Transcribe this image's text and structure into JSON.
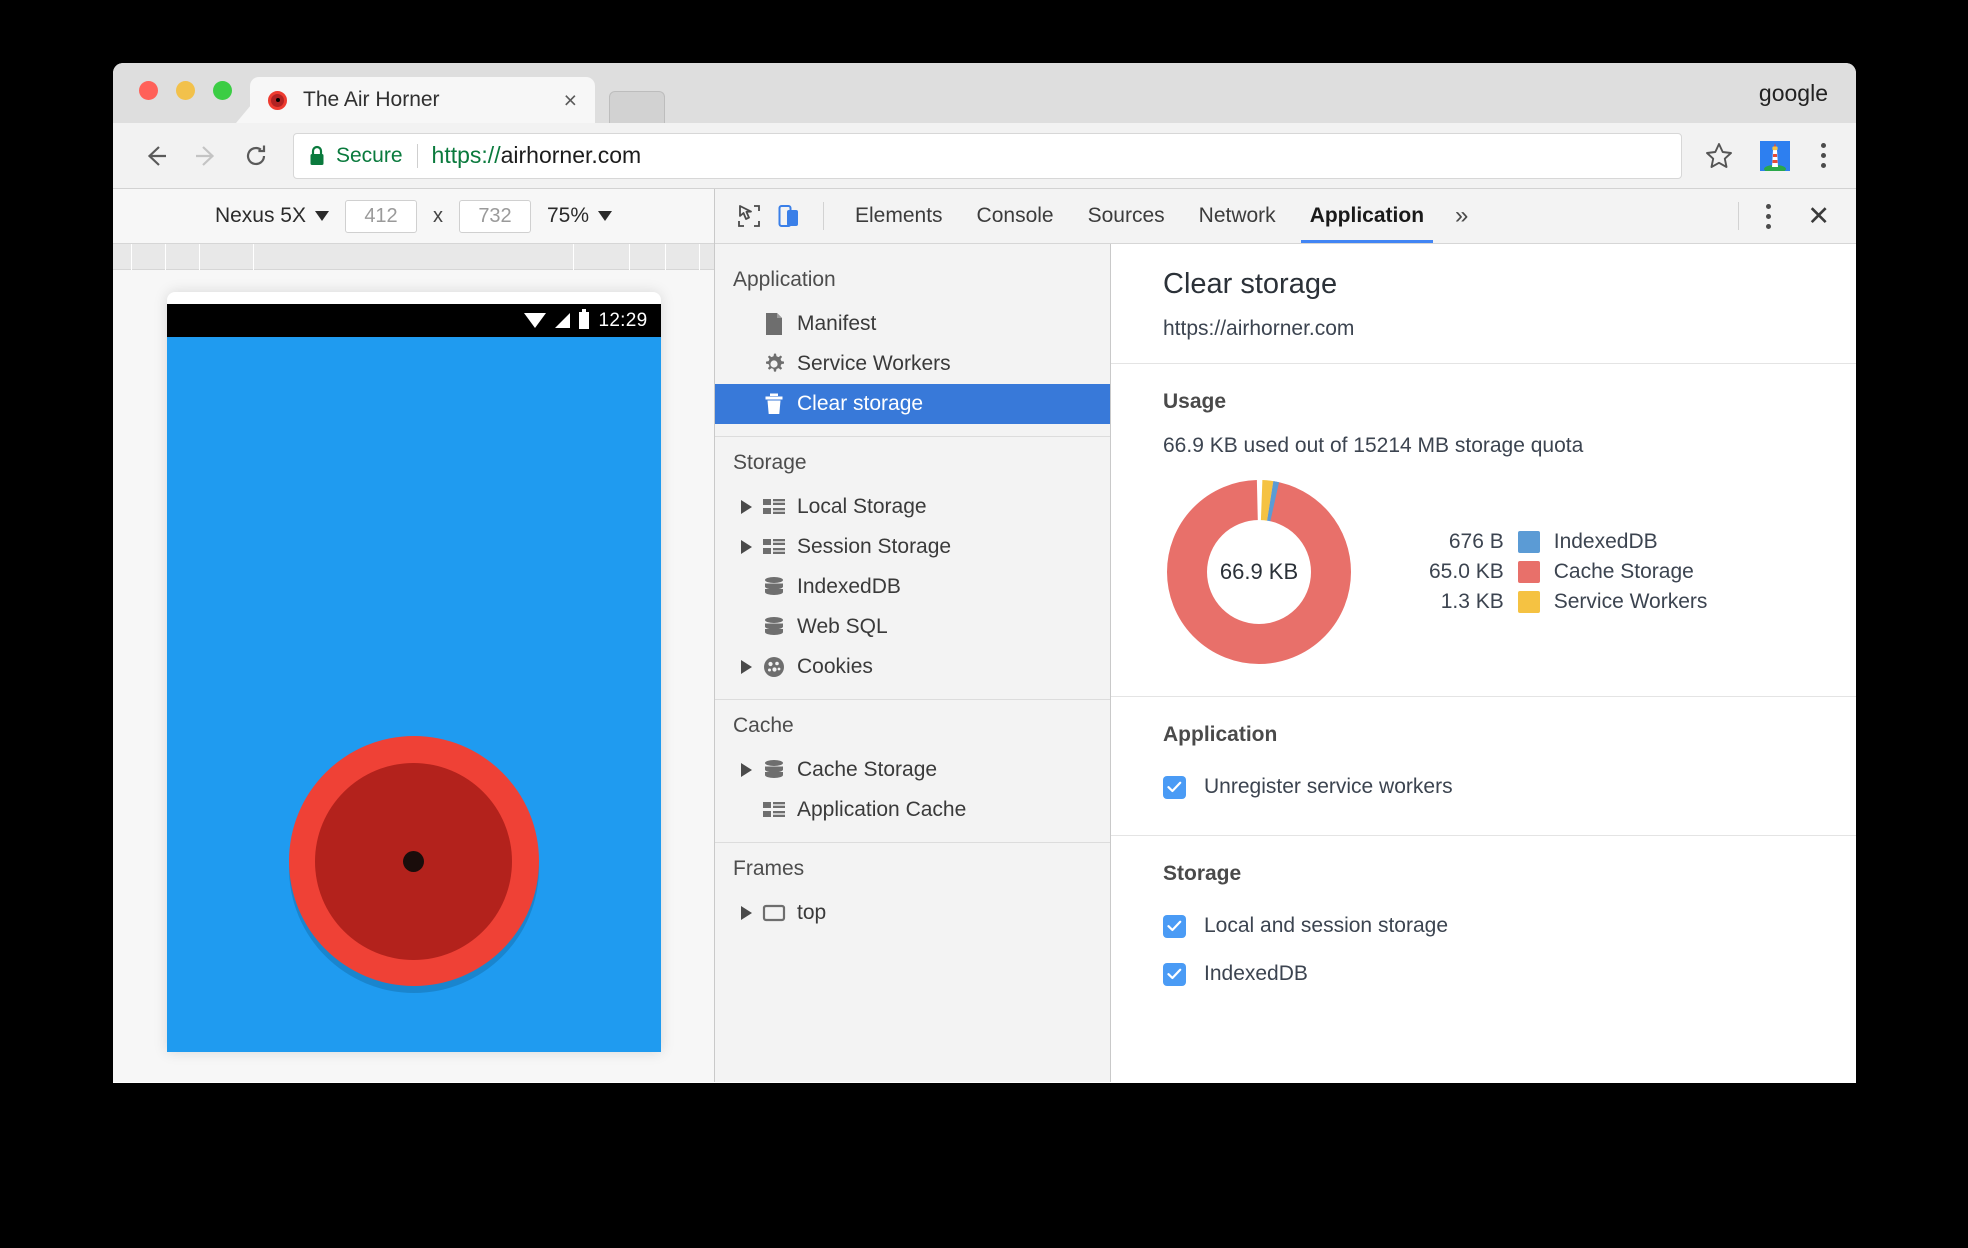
{
  "window": {
    "profile_name": "google"
  },
  "tab": {
    "title": "The Air Horner",
    "close_label": "×",
    "favicon": "air-horn-favicon"
  },
  "omnibox": {
    "secure_label": "Secure",
    "url_scheme": "https://",
    "url_host": "airhorner.com",
    "back_icon": "back-arrow-icon",
    "forward_icon": "forward-arrow-icon",
    "reload_icon": "reload-icon",
    "star_icon": "bookmark-star-icon",
    "extension_icon": "lighthouse-extension-icon",
    "menu_icon": "chrome-menu-icon"
  },
  "device_toolbar": {
    "device_name": "Nexus 5X",
    "width": "412",
    "height": "732",
    "multiply": "x",
    "zoom": "75%"
  },
  "device_screen": {
    "status_clock": "12:29",
    "wifi_icon": "wifi-icon",
    "signal_icon": "cell-signal-icon",
    "battery_icon": "battery-icon",
    "horn_button": "air-horn-button",
    "background_color": "#1f9bf0",
    "horn_outer_color": "#ef4136",
    "horn_inner_color": "#b3221c"
  },
  "devtools": {
    "inspect_icon": "inspect-element-icon",
    "device_toggle_icon": "toggle-device-toolbar-icon",
    "tabs": [
      {
        "label": "Elements",
        "active": false
      },
      {
        "label": "Console",
        "active": false
      },
      {
        "label": "Sources",
        "active": false
      },
      {
        "label": "Network",
        "active": false
      },
      {
        "label": "Application",
        "active": true
      }
    ],
    "more_tabs_label": "»",
    "menu_icon": "devtools-menu-icon",
    "close_label": "✕",
    "accent_color": "#4285f4"
  },
  "sidebar": {
    "sections": [
      {
        "title": "Application",
        "items": [
          {
            "label": "Manifest",
            "icon": "manifest-document-icon",
            "expandable": false,
            "selected": false
          },
          {
            "label": "Service Workers",
            "icon": "gear-icon",
            "expandable": false,
            "selected": false
          },
          {
            "label": "Clear storage",
            "icon": "trash-icon",
            "expandable": false,
            "selected": true
          }
        ]
      },
      {
        "title": "Storage",
        "items": [
          {
            "label": "Local Storage",
            "icon": "table-icon",
            "expandable": true,
            "selected": false
          },
          {
            "label": "Session Storage",
            "icon": "table-icon",
            "expandable": true,
            "selected": false
          },
          {
            "label": "IndexedDB",
            "icon": "database-icon",
            "expandable": false,
            "selected": false
          },
          {
            "label": "Web SQL",
            "icon": "database-icon",
            "expandable": false,
            "selected": false
          },
          {
            "label": "Cookies",
            "icon": "cookie-icon",
            "expandable": true,
            "selected": false
          }
        ]
      },
      {
        "title": "Cache",
        "items": [
          {
            "label": "Cache Storage",
            "icon": "database-icon",
            "expandable": true,
            "selected": false
          },
          {
            "label": "Application Cache",
            "icon": "table-icon",
            "expandable": false,
            "selected": false
          }
        ]
      },
      {
        "title": "Frames",
        "items": [
          {
            "label": "top",
            "icon": "frame-icon",
            "expandable": true,
            "selected": false
          }
        ]
      }
    ],
    "selected_color": "#3879d9"
  },
  "clear_storage": {
    "title": "Clear storage",
    "origin": "https://airhorner.com",
    "usage": {
      "section_title": "Usage",
      "summary": "66.9 KB used out of 15214 MB storage quota",
      "center_label": "66.9 KB"
    },
    "application_section": {
      "title": "Application",
      "options": [
        {
          "label": "Unregister service workers",
          "checked": true
        }
      ]
    },
    "storage_section": {
      "title": "Storage",
      "options": [
        {
          "label": "Local and session storage",
          "checked": true
        },
        {
          "label": "IndexedDB",
          "checked": true
        }
      ]
    }
  },
  "chart_data": {
    "type": "pie",
    "title": "Usage",
    "subtitle": "66.9 KB used out of 15214 MB storage quota",
    "center_label": "66.9 KB",
    "categories": [
      "IndexedDB",
      "Cache Storage",
      "Service Workers"
    ],
    "value_labels": [
      "676 B",
      "65.0 KB",
      "1.3 KB"
    ],
    "values_bytes": [
      676,
      66560,
      1331
    ],
    "percentages": [
      1.0,
      97.1,
      1.9
    ],
    "colors": [
      "#5b9bd5",
      "#e8706a",
      "#f5c242"
    ],
    "legend_position": "right",
    "donut": true,
    "total_bytes": 68567,
    "total_label": "66.9 KB",
    "quota_label": "15214 MB"
  }
}
